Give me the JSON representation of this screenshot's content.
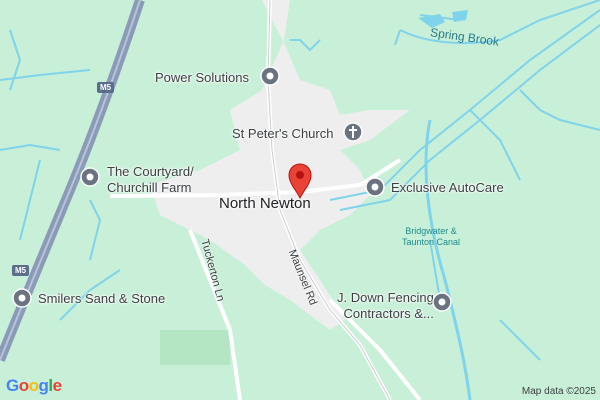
{
  "map": {
    "place_name": "North Newton",
    "pois": [
      {
        "id": "power",
        "label": "Power Solutions"
      },
      {
        "id": "church",
        "label": "St Peter's Church"
      },
      {
        "id": "courtyard",
        "label_line1": "The Courtyard/",
        "label_line2": "Churchill Farm"
      },
      {
        "id": "autocare",
        "label": "Exclusive AutoCare"
      },
      {
        "id": "smilers",
        "label": "Smilers Sand & Stone"
      },
      {
        "id": "fencing",
        "label_line1": "J. Down Fencing",
        "label_line2": "Contractors &..."
      }
    ],
    "water": {
      "spring_brook": "Spring Brook",
      "canal_line1": "Bridgwater &",
      "canal_line2": "Taunton Canal"
    },
    "roads": {
      "tuckerton": "Tuckerton Ln",
      "maunsel": "Maunsel Rd",
      "motorway_shield": "M5"
    },
    "branding": {
      "google": "Google",
      "attribution": "Map data ©2025"
    },
    "colors": {
      "land": "#c8f0d8",
      "village": "#eeeeee",
      "water": "#7fd3ea",
      "motorway": "#8a9bb8",
      "pin": "#ea4335"
    }
  }
}
